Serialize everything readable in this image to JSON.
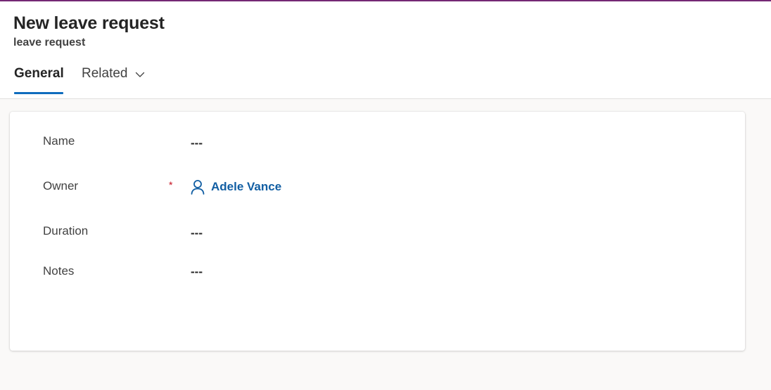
{
  "colors": {
    "accent_bar": "#742774",
    "tab_underline": "#0f6cbd",
    "link": "#115ea3",
    "required": "#c50f1f"
  },
  "header": {
    "title": "New leave request",
    "subtitle": "leave request"
  },
  "tabs": [
    {
      "label": "General",
      "active": true
    },
    {
      "label": "Related",
      "active": false,
      "icon": "chevron-down-icon"
    }
  ],
  "form": {
    "fields": [
      {
        "label": "Name",
        "value": "---"
      },
      {
        "label": "Owner",
        "required_marker": "*",
        "value": "Adele Vance",
        "icon": "person-icon"
      },
      {
        "label": "Duration",
        "value": "---"
      },
      {
        "label": "Notes",
        "value": "---"
      }
    ]
  }
}
